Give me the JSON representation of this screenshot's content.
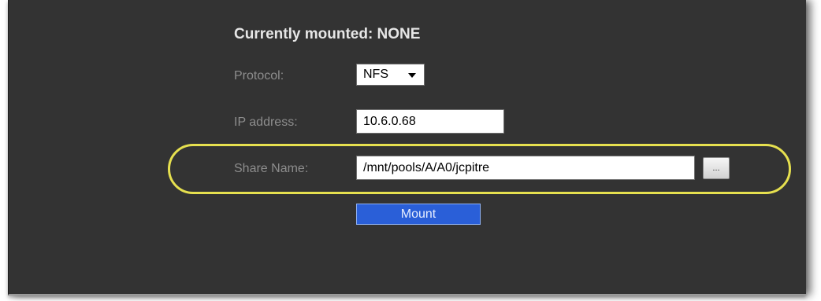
{
  "panel": {
    "title": "Currently mounted: NONE",
    "protocol": {
      "label": "Protocol:",
      "value": "NFS"
    },
    "ip_address": {
      "label": "IP address:",
      "value": "10.6.0.68"
    },
    "share_name": {
      "label": "Share Name:",
      "value": "/mnt/pools/A/A0/jcpitre",
      "browse_label": "..."
    },
    "mount_label": "Mount"
  },
  "colors": {
    "panel_bg": "#333333",
    "title": "#e6e6e6",
    "label": "#8d8d8d",
    "mount_button": "#2a5fd8",
    "highlight_ring": "#e6e04f"
  },
  "icons": {
    "dropdown": "caret-down-icon"
  }
}
